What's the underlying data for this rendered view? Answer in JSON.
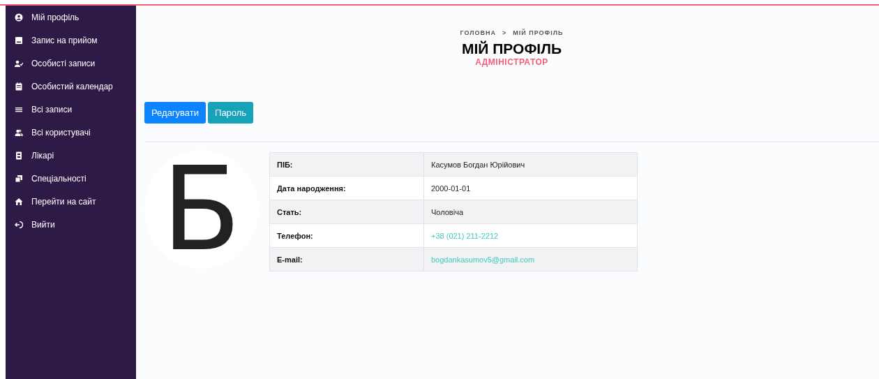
{
  "sidebar": {
    "items": [
      {
        "label": "Мій профіль"
      },
      {
        "label": "Запис на прийом"
      },
      {
        "label": "Особисті записи"
      },
      {
        "label": "Особистий календар"
      },
      {
        "label": "Всі записи"
      },
      {
        "label": "Всі користувачі"
      },
      {
        "label": "Лікарі"
      },
      {
        "label": "Спеціальності"
      },
      {
        "label": "Перейти на сайт"
      },
      {
        "label": "Вийти"
      }
    ]
  },
  "breadcrumb": {
    "items": [
      "ГОЛОВНА",
      "МІЙ ПРОФІЛЬ"
    ],
    "separator": ">"
  },
  "header": {
    "title": "МІЙ ПРОФІЛЬ",
    "role": "АДМІНІСТРАТОР"
  },
  "buttons": [
    {
      "label": "Редагувати",
      "kind": "primary"
    },
    {
      "label": "Пароль",
      "kind": "info"
    }
  ],
  "avatar": {
    "letter": "Б"
  },
  "profile_table": {
    "rows": [
      {
        "label": "ПІБ:",
        "value": "Касумов Богдан Юрійович",
        "kind": "text"
      },
      {
        "label": "Дата народження:",
        "value": "2000-01-01",
        "kind": "text"
      },
      {
        "label": "Стать:",
        "value": "Чоловіча",
        "kind": "text"
      },
      {
        "label": "Телефон:",
        "value": "+38 (021) 211-2212",
        "kind": "link"
      },
      {
        "label": "E-mail:",
        "value": "bogdankasumov5@gmail.com",
        "kind": "link"
      }
    ]
  }
}
